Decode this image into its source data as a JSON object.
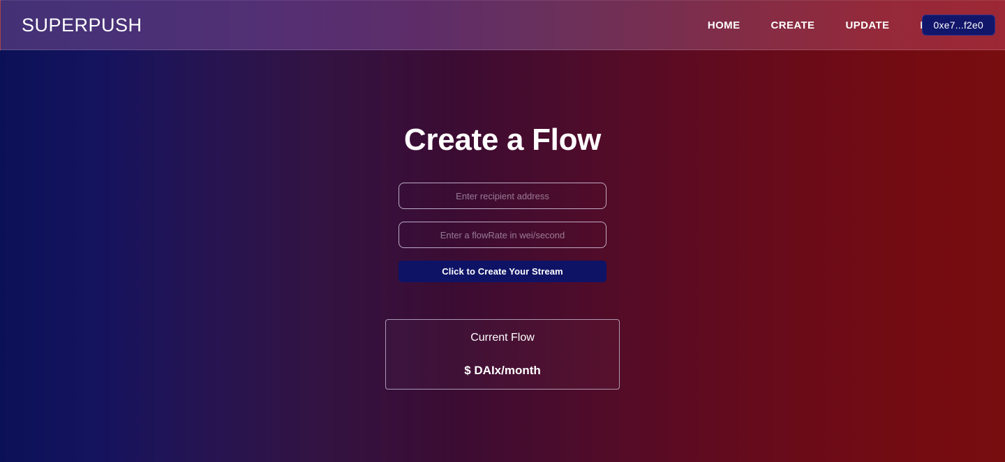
{
  "header": {
    "brand": "SUPERPUSH",
    "nav_items": [
      {
        "label": "HOME",
        "name": "nav-link-home"
      },
      {
        "label": "CREATE",
        "name": "nav-link-create"
      },
      {
        "label": "UPDATE",
        "name": "nav-link-update"
      },
      {
        "label": "DELETE",
        "name": "nav-link-delete"
      }
    ],
    "wallet_label": "0xe7...f2e0"
  },
  "main": {
    "title": "Create a Flow",
    "recipient_input": {
      "value": "",
      "placeholder": "Enter recipient address"
    },
    "flowrate_input": {
      "value": "",
      "placeholder": "Enter a flowRate in wei/second"
    },
    "submit_label": "Click to Create Your Stream",
    "flow_card": {
      "title": "Current Flow",
      "amount": "",
      "value": "$ DAIx/month"
    }
  },
  "colors": {
    "body_gradient_start": "#0b1157",
    "body_gradient_mid": "#3b0c33",
    "body_gradient_end": "#780d10",
    "header_gradient_start": "#443175",
    "header_gradient_end": "#9d2734",
    "accent_navy": "#0e1366",
    "wallet_navy": "#11166a",
    "text_primary": "#ffffff",
    "border_light": "#e2d8f0"
  }
}
